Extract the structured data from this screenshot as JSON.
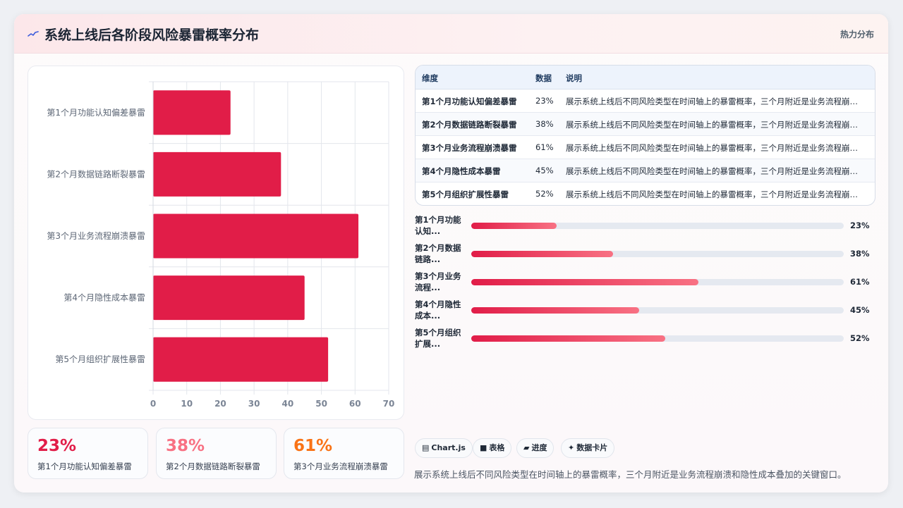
{
  "header": {
    "icon": "sparkline-icon",
    "title": "系统上线后各阶段风险暴雷概率分布",
    "tag": "热力分布"
  },
  "chart_data": {
    "type": "bar",
    "orientation": "horizontal",
    "categories": [
      "第1个月功能认知偏差暴雷",
      "第2个月数据链路断裂暴雷",
      "第3个月业务流程崩溃暴雷",
      "第4个月隐性成本暴雷",
      "第5个月组织扩展性暴雷"
    ],
    "values": [
      23,
      38,
      61,
      45,
      52
    ],
    "xlim": [
      0,
      70
    ],
    "ticks": [
      "0",
      "10",
      "20",
      "30",
      "40",
      "50",
      "60",
      "70"
    ],
    "grid": true,
    "color": "#e11d48"
  },
  "kpis": [
    {
      "value": "23%",
      "label": "第1个月功能认知偏差暴雷",
      "color": "#e11d48"
    },
    {
      "value": "38%",
      "label": "第2个月数据链路断裂暴雷",
      "color": "#f87183"
    },
    {
      "value": "61%",
      "label": "第3个月业务流程崩溃暴雷",
      "color": "#f97316"
    }
  ],
  "table": {
    "headers": [
      "维度",
      "数据",
      "说明"
    ],
    "rows": [
      {
        "dim": "第1个月功能认知偏差暴雷",
        "value": "23%",
        "desc": "展示系统上线后不同风险类型在时间轴上的暴雷概率，三个月附近是业务流程崩溃和隐性成本叠加的关键窗口。"
      },
      {
        "dim": "第2个月数据链路断裂暴雷",
        "value": "38%",
        "desc": "展示系统上线后不同风险类型在时间轴上的暴雷概率，三个月附近是业务流程崩溃和隐性成本叠加的关键窗口。"
      },
      {
        "dim": "第3个月业务流程崩溃暴雷",
        "value": "61%",
        "desc": "展示系统上线后不同风险类型在时间轴上的暴雷概率，三个月附近是业务流程崩溃和隐性成本叠加的关键窗口。"
      },
      {
        "dim": "第4个月隐性成本暴雷",
        "value": "45%",
        "desc": "展示系统上线后不同风险类型在时间轴上的暴雷概率，三个月附近是业务流程崩溃和隐性成本叠加的关键窗口。"
      },
      {
        "dim": "第5个月组织扩展性暴雷",
        "value": "52%",
        "desc": "展示系统上线后不同风险类型在时间轴上的暴雷概率，三个月附近是业务流程崩溃和隐性成本叠加的关键窗口。"
      }
    ]
  },
  "progress": [
    {
      "label": "第1个月功能认知...",
      "value": "23%",
      "fraction": 0.23
    },
    {
      "label": "第2个月数据链路...",
      "value": "38%",
      "fraction": 0.38
    },
    {
      "label": "第3个月业务流程...",
      "value": "61%",
      "fraction": 0.61
    },
    {
      "label": "第4个月隐性成本...",
      "value": "45%",
      "fraction": 0.45
    },
    {
      "label": "第5个月组织扩展...",
      "value": "52%",
      "fraction": 0.52
    }
  ],
  "chips": [
    {
      "icon": "▤",
      "label": "Chart.js",
      "icon_name": "chart-icon"
    },
    {
      "icon": "■",
      "label": "表格",
      "icon_name": "table-icon"
    },
    {
      "icon": "▰",
      "label": "进度",
      "icon_name": "progress-icon"
    },
    {
      "icon": "✦",
      "label": "数据卡片",
      "icon_name": "card-icon"
    }
  ],
  "footnote": "展示系统上线后不同风险类型在时间轴上的暴雷概率，三个月附近是业务流程崩溃和隐性成本叠加的关键窗口。"
}
